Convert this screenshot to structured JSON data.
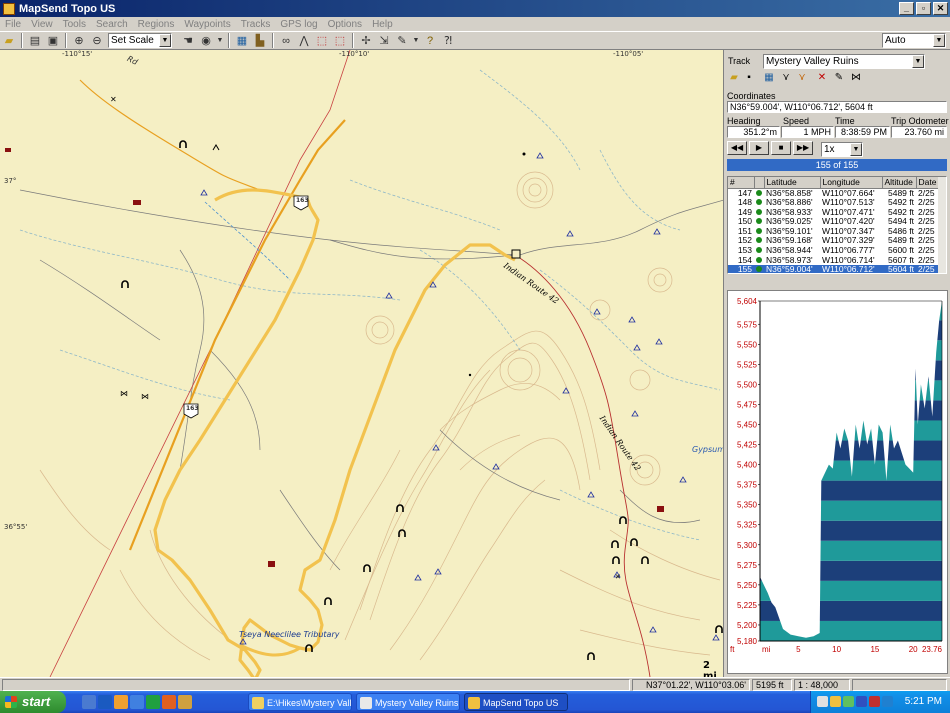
{
  "window": {
    "title": "MapSend Topo US"
  },
  "menu": [
    "File",
    "View",
    "Tools",
    "Search",
    "Regions",
    "Waypoints",
    "Tracks",
    "GPS log",
    "Options",
    "Help"
  ],
  "toolbar": {
    "scale_value": "Set Scale",
    "zoom_mode": "Auto"
  },
  "map": {
    "graticule": [
      "-110°15'",
      "-110°10'",
      "-110°05'",
      "37°",
      "36°55'"
    ],
    "road_shields": [
      "163",
      "163"
    ],
    "labels": {
      "indian_route_1": "Indian Route 42",
      "indian_route_2": "Indian Route 42",
      "gypsum": "Gypsum",
      "tributary": "Tseya Neeclilee Tributary",
      "road_rd": "Rd"
    },
    "scale_text": "2 mi",
    "colors": {
      "background": "#f5efc4",
      "track": "#f2c24e",
      "road": "#f0a030",
      "boundary": "#c03030"
    }
  },
  "panel": {
    "track_label": "Track",
    "track_name": "Mystery Valley Ruins",
    "coordinates_label": "Coordinates",
    "coordinates_value": "N36°59.004', W110°06.712', 5604 ft",
    "heading_label": "Heading",
    "speed_label": "Speed",
    "time_label": "Time",
    "odometer_label": "Trip Odometer",
    "heading_value": "351.2°m",
    "speed_value": "1 MPH",
    "time_value": "8:38:59 PM",
    "odometer_value": "23.760 mi",
    "playback_speed": "1x",
    "point_count": "155 of 155"
  },
  "points_table": {
    "headers": [
      "#",
      "",
      "Latitude",
      "Longitude",
      "Altitude",
      "Date"
    ],
    "rows": [
      [
        "147",
        "N36°58.858'",
        "W110°07.664'",
        "5489 ft",
        "2/25"
      ],
      [
        "148",
        "N36°58.886'",
        "W110°07.513'",
        "5492 ft",
        "2/25"
      ],
      [
        "149",
        "N36°58.933'",
        "W110°07.471'",
        "5492 ft",
        "2/25"
      ],
      [
        "150",
        "N36°59.025'",
        "W110°07.420'",
        "5494 ft",
        "2/25"
      ],
      [
        "151",
        "N36°59.101'",
        "W110°07.347'",
        "5486 ft",
        "2/25"
      ],
      [
        "152",
        "N36°59.168'",
        "W110°07.329'",
        "5489 ft",
        "2/25"
      ],
      [
        "153",
        "N36°58.944'",
        "W110°06.777'",
        "5600 ft",
        "2/25"
      ],
      [
        "154",
        "N36°58.973'",
        "W110°06.714'",
        "5607 ft",
        "2/25"
      ],
      [
        "155",
        "N36°59.004'",
        "W110°06.712'",
        "5604 ft",
        "2/25"
      ]
    ],
    "selected_index": 8
  },
  "chart_data": {
    "type": "area",
    "xlabel": "mi",
    "ylabel": "ft",
    "xlim": [
      0,
      23.76
    ],
    "ylim": [
      5180,
      5604
    ],
    "x_ticks": [
      "mi",
      "5",
      "10",
      "15",
      "20",
      "23.76"
    ],
    "y_ticks": [
      "5,604",
      "5,575",
      "5,550",
      "5,525",
      "5,500",
      "5,475",
      "5,450",
      "5,425",
      "5,400",
      "5,375",
      "5,350",
      "5,325",
      "5,300",
      "5,275",
      "5,250",
      "5,225",
      "5,200",
      "5,180"
    ],
    "x": [
      0,
      0.5,
      1,
      1.5,
      2,
      3,
      4,
      5,
      6,
      7,
      7.8,
      8,
      8.5,
      9,
      9.5,
      10,
      10.5,
      11,
      11.5,
      12,
      12.5,
      13,
      13.5,
      14,
      14.5,
      15,
      15.5,
      16,
      16.5,
      17,
      17.5,
      18,
      18.5,
      19,
      19.5,
      20,
      20.3,
      20.6,
      21,
      21.5,
      22,
      22.5,
      23,
      23.4,
      23.76
    ],
    "y": [
      5260,
      5250,
      5240,
      5228,
      5222,
      5195,
      5188,
      5186,
      5184,
      5186,
      5190,
      5380,
      5390,
      5400,
      5395,
      5440,
      5420,
      5445,
      5430,
      5385,
      5450,
      5420,
      5455,
      5425,
      5445,
      5400,
      5450,
      5440,
      5380,
      5450,
      5420,
      5430,
      5415,
      5400,
      5395,
      5390,
      5520,
      5450,
      5500,
      5470,
      5510,
      5460,
      5540,
      5580,
      5604
    ],
    "colors": {
      "fill_dark": "#1c3f7a",
      "fill_light": "#1f9a9a"
    }
  },
  "status": {
    "cursor_coords": "N37°01.22', W110°03.06'",
    "elevation": "5195 ft",
    "scale": "1 : 48,000"
  },
  "taskbar": {
    "start_label": "start",
    "tasks": [
      "E:\\Hikes\\Mystery Vall...",
      "Mystery Valley Ruins ...",
      "MapSend Topo US"
    ],
    "clock": "5:21 PM"
  }
}
